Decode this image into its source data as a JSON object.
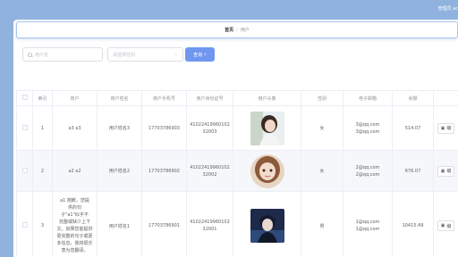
{
  "header": {
    "admin_label": "管理员 ac"
  },
  "breadcrumb": {
    "home": "首页",
    "separator": "/",
    "current": "用户"
  },
  "filters": {
    "search_placeholder": "用户名",
    "gender_placeholder": "请选择性别",
    "query_label": "查询"
  },
  "table": {
    "headers": [
      "索引",
      "账户",
      "用户姓名",
      "用户手机号",
      "用户身份证号",
      "用户头像",
      "性别",
      "电子邮箱",
      "余额"
    ],
    "rows": [
      {
        "index": "1",
        "account": "a3 a3",
        "name": "用户姓名3",
        "phone": "17703786903",
        "id_line1": "41022419960102",
        "id_line2": "32003",
        "gender": "女",
        "email_line1": "3@qq.com",
        "email_line2": "3@qq.com",
        "balance": "514.07",
        "action": "编"
      },
      {
        "index": "2",
        "account": "a2 a2",
        "name": "用户姓名2",
        "phone": "17703786902",
        "id_line1": "41022419960102",
        "id_line2": "32002",
        "gender": "女",
        "email_line1": "2@qq.com",
        "email_line2": "2@qq.com",
        "balance": "676.07",
        "action": "编"
      },
      {
        "index": "3",
        "account_lines": [
          "a1 抱歉，您提",
          "供的句",
          "子\"a1\"似乎不",
          "完整或缺少上下",
          "文。如果您能提供",
          "更完整的句子或更",
          "多信息，我将很乐",
          "意为您翻译。"
        ],
        "name": "用户姓名1",
        "phone": "17703786901",
        "id_line1": "41022419960102",
        "id_line2": "32001",
        "gender": "男",
        "email_line1": "1@qq.com",
        "email_line2": "1@qq.com",
        "balance": "10415.49",
        "action": "编"
      }
    ]
  },
  "colors": {
    "accent": "#6f97f0",
    "sidebar": "#8fb3de",
    "success": "#67c23a"
  }
}
